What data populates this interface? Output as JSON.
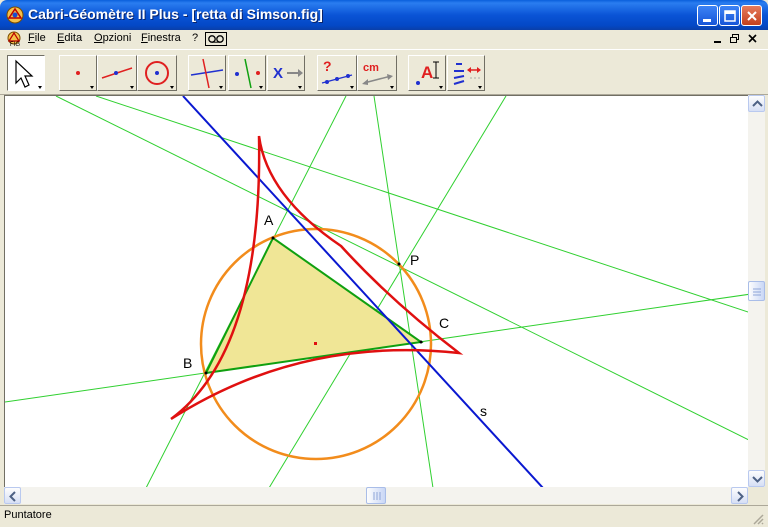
{
  "window": {
    "title": "Cabri-Géomètre II Plus - [retta di Simson.fig]"
  },
  "menu": {
    "items": [
      {
        "label": "File"
      },
      {
        "label": "Edita"
      },
      {
        "label": "Opzioni"
      },
      {
        "label": "Finestra"
      },
      {
        "label": "?"
      }
    ]
  },
  "toolbar": {
    "tools": [
      {
        "name": "pointer-tool",
        "icon": "arrow-pointer-icon",
        "selected": true
      },
      {
        "name": "points-tool",
        "icon": "point-icon"
      },
      {
        "name": "lines-tool",
        "icon": "segment-icon"
      },
      {
        "name": "curves-tool",
        "icon": "circle-icon"
      },
      {
        "name": "constructions-tool",
        "icon": "perpendicular-icon"
      },
      {
        "name": "transformations-tool",
        "icon": "symmetry-icon"
      },
      {
        "name": "macro-tool",
        "icon": "macro-icon"
      },
      {
        "name": "properties-tool",
        "icon": "collinear-check-icon"
      },
      {
        "name": "measure-tool",
        "icon": "distance-measure-icon"
      },
      {
        "name": "text-tool",
        "icon": "label-text-icon"
      },
      {
        "name": "attributes-tool",
        "icon": "attributes-icon"
      }
    ],
    "labels": {
      "measure": "cm",
      "question": "?",
      "text": "A",
      "x": "X"
    }
  },
  "figure": {
    "points": {
      "A": "A",
      "B": "B",
      "C": "C",
      "P": "P"
    },
    "line_label": "s",
    "colors": {
      "circle": "#f28c1c",
      "deltoid": "#e01010",
      "simson": "#0a18d0",
      "lines": "#30d030",
      "triangle_fill": "#f0e696",
      "triangle_edge": "#10a010"
    }
  },
  "status": {
    "text": "Puntatore"
  }
}
